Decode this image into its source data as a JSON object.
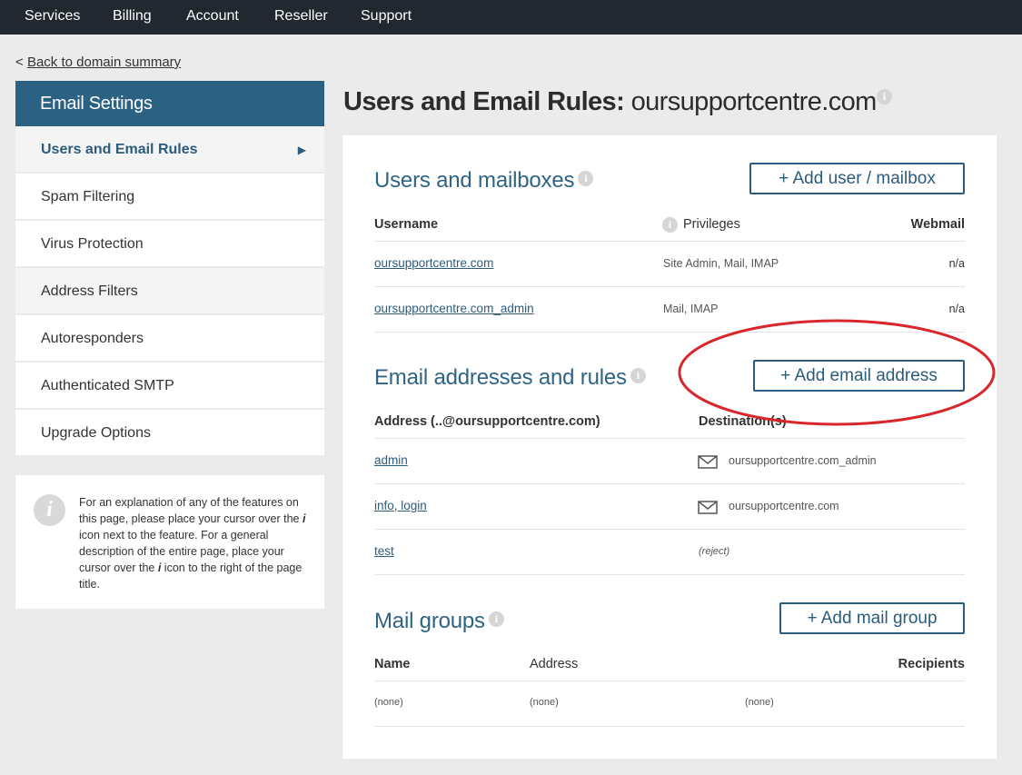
{
  "topnav": {
    "services": "Services",
    "billing": "Billing",
    "account": "Account",
    "reseller": "Reseller",
    "support": "Support"
  },
  "back": {
    "prefix": "<",
    "label": "Back to domain summary"
  },
  "sidebar": {
    "title": "Email Settings",
    "items": [
      {
        "label": "Users and Email Rules"
      },
      {
        "label": "Spam Filtering"
      },
      {
        "label": "Virus Protection"
      },
      {
        "label": "Address Filters"
      },
      {
        "label": "Autoresponders"
      },
      {
        "label": "Authenticated SMTP"
      },
      {
        "label": "Upgrade Options"
      }
    ],
    "active_marker": "▶"
  },
  "info_icon_glyph": "i",
  "infobox": {
    "part1": "For an explanation of any of the features on this page, please place your cursor over the ",
    "i1": "i",
    "part2": " icon next to the feature. For a general description of the entire page, place your cursor over the ",
    "i2": "i",
    "part3": " icon to the right of the page title."
  },
  "page_title": {
    "bold": "Users and Email Rules:",
    "domain": "oursupportcentre.com"
  },
  "users": {
    "title": "Users and mailboxes",
    "add_button": "+ Add user / mailbox",
    "headers": {
      "username": "Username",
      "privileges": "Privileges",
      "webmail": "Webmail"
    },
    "rows": [
      {
        "username": "oursupportcentre.com",
        "privileges": "Site Admin, Mail, IMAP",
        "webmail": "n/a"
      },
      {
        "username": "oursupportcentre.com_admin",
        "privileges": "Mail, IMAP",
        "webmail": "n/a"
      }
    ]
  },
  "addresses": {
    "title": "Email addresses and rules",
    "add_button": "+ Add email address",
    "headers": {
      "address": "Address (..@oursupportcentre.com)",
      "destination": "Destination(s)"
    },
    "rows": [
      {
        "address": "admin",
        "destination": "oursupportcentre.com_admin"
      },
      {
        "address_a": "info",
        "sep": ", ",
        "address_b": "login",
        "destination": "oursupportcentre.com"
      },
      {
        "address": "test",
        "destination": "(reject)"
      }
    ]
  },
  "groups": {
    "title": "Mail groups",
    "add_button": "+ Add mail group",
    "headers": {
      "name": "Name",
      "address": "Address",
      "recipients": "Recipients"
    },
    "rows": [
      {
        "name": "(none)",
        "address": "(none)",
        "recipients": "(none)"
      }
    ]
  },
  "colors": {
    "nav_bg": "#212830",
    "accent": "#2b6283",
    "annotation": "#d8262b"
  }
}
